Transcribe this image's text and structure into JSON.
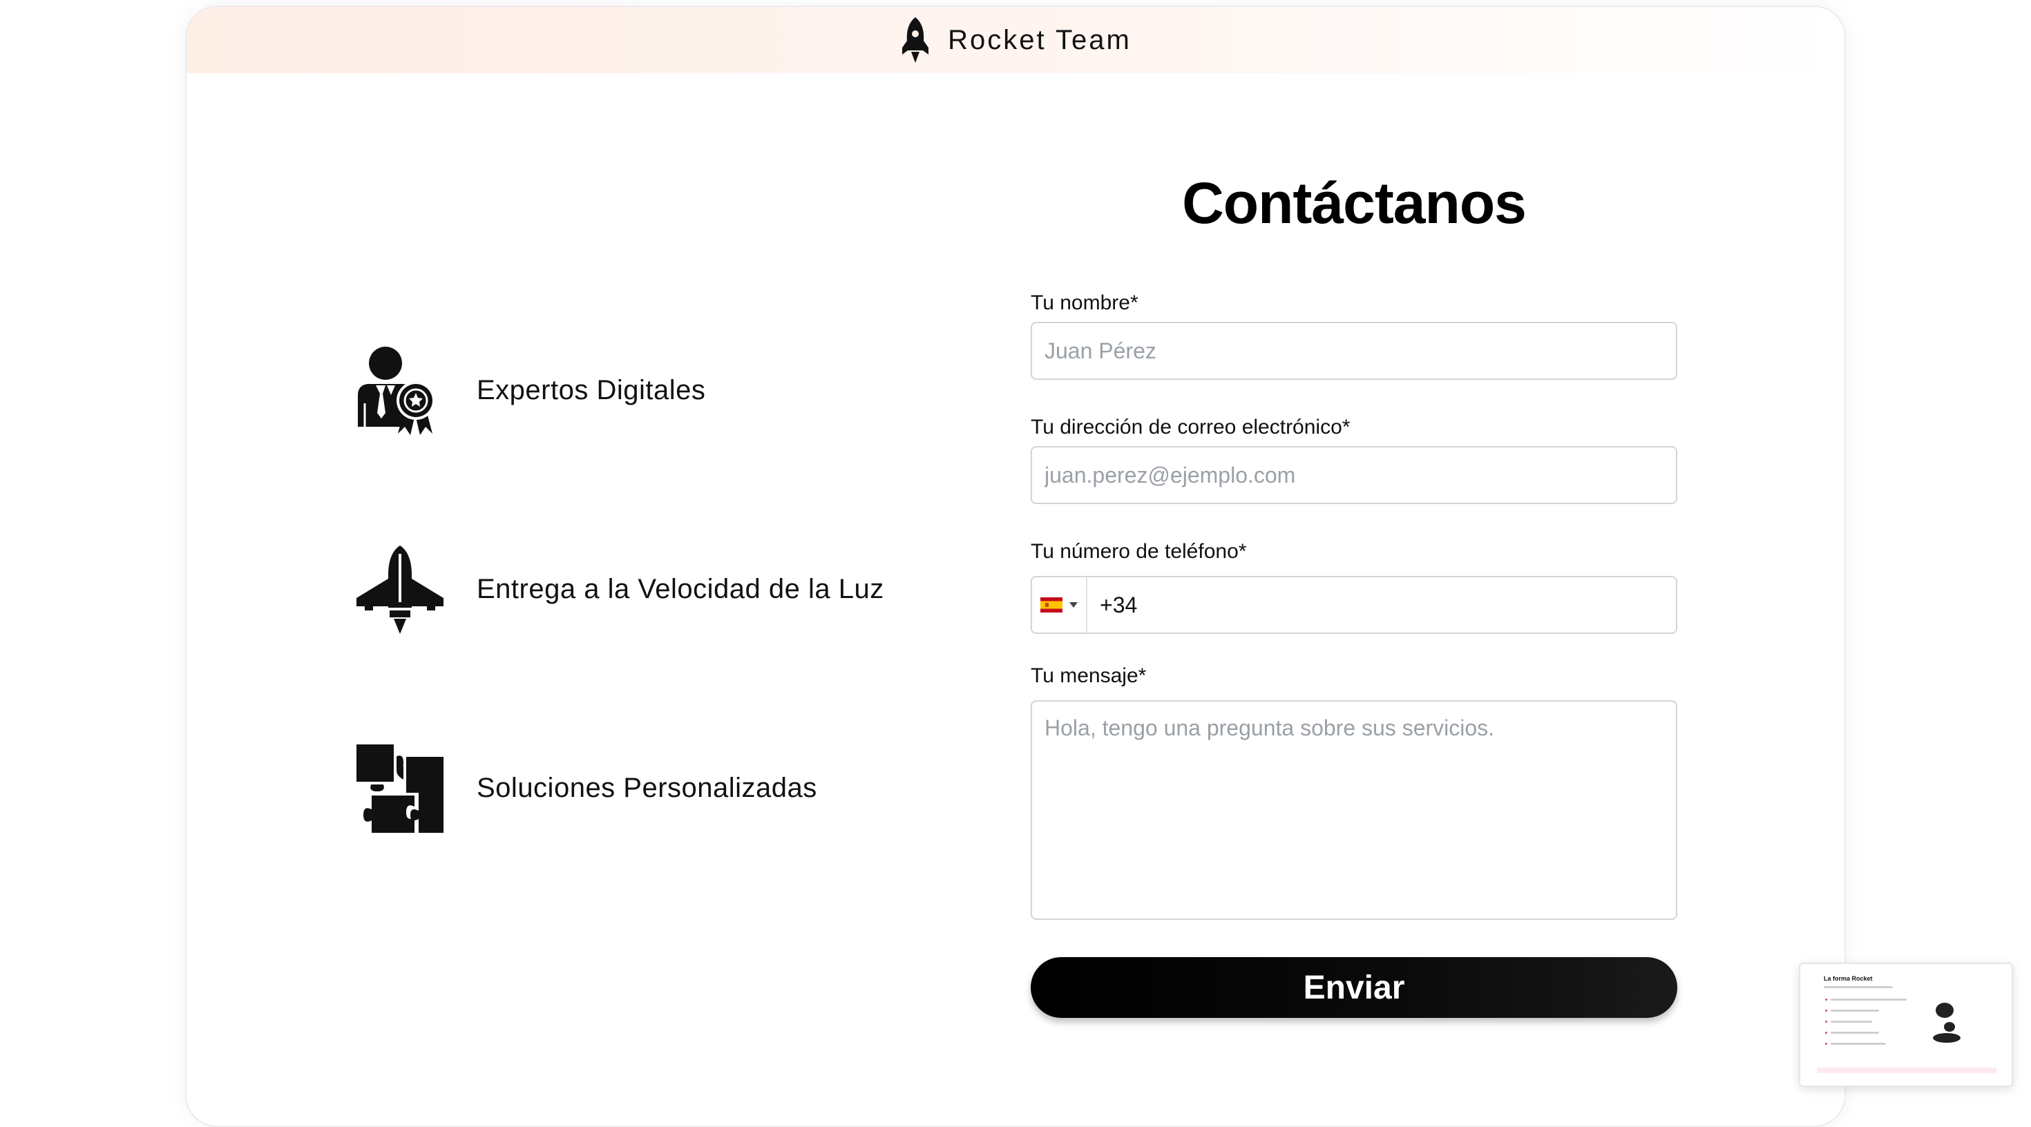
{
  "header": {
    "brand_name": "Rocket Team",
    "brand_icon": "rocket-icon"
  },
  "features": [
    {
      "label": "Expertos Digitales",
      "icon": "expert-award-icon"
    },
    {
      "label": "Entrega a la Velocidad de la Luz",
      "icon": "jet-icon"
    },
    {
      "label": "Soluciones Personalizadas",
      "icon": "puzzle-icon"
    }
  ],
  "form": {
    "title": "Contáctanos",
    "name": {
      "label": "Tu nombre*",
      "placeholder": "Juan Pérez",
      "value": ""
    },
    "email": {
      "label": "Tu dirección de correo electrónico*",
      "placeholder": "juan.perez@ejemplo.com",
      "value": ""
    },
    "phone": {
      "label": "Tu número de teléfono*",
      "country": "ES",
      "value": "+34"
    },
    "message": {
      "label": "Tu mensaje*",
      "placeholder": "Hola, tengo una pregunta sobre sus servicios.",
      "value": ""
    },
    "submit_label": "Enviar"
  },
  "preview_thumbnail": {
    "title": "La forma Rocket"
  },
  "colors": {
    "header_gradient_start": "#fdeee6",
    "button_bg": "#000000",
    "button_text": "#ffffff",
    "input_border": "#d4d4d4",
    "placeholder": "#9aa0a6"
  }
}
